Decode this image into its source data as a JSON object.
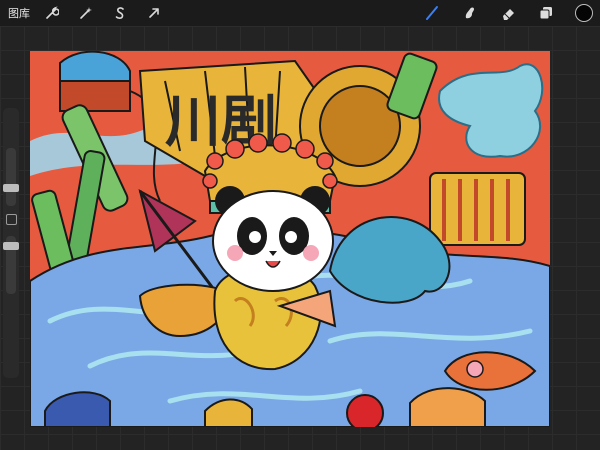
{
  "toolbar": {
    "gallery_label": "图库",
    "left_tools": [
      {
        "name": "actions-wrench-icon"
      },
      {
        "name": "adjustments-magic-wand-icon"
      },
      {
        "name": "selection-s-icon"
      },
      {
        "name": "transform-arrow-icon"
      }
    ],
    "right_tools": [
      {
        "name": "brush-icon",
        "active": true
      },
      {
        "name": "smudge-icon"
      },
      {
        "name": "eraser-icon"
      },
      {
        "name": "layers-icon"
      }
    ],
    "current_color": "#050505"
  },
  "canvas": {
    "artwork_text": "川剧"
  },
  "colors": {
    "accent_blue": "#3b7ff2",
    "canvas_background": "#e65a3f"
  }
}
